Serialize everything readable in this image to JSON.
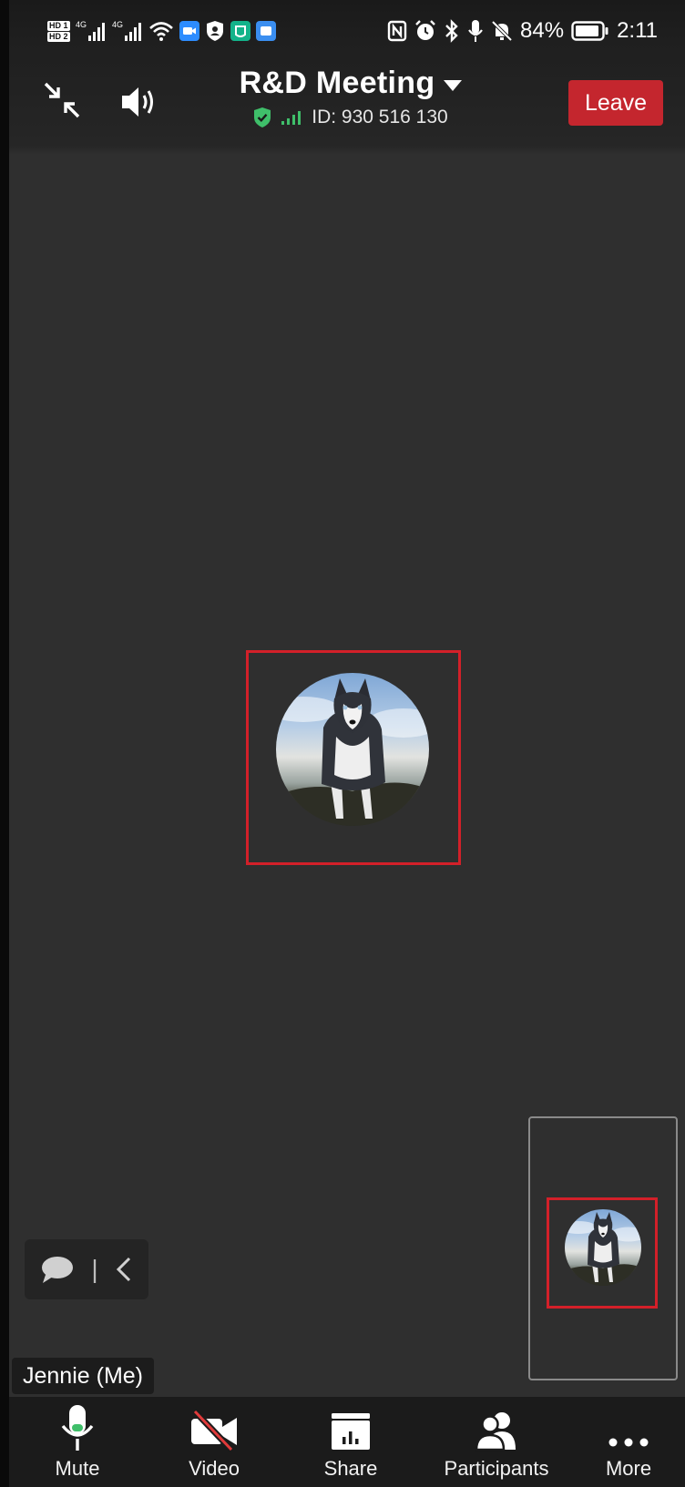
{
  "status_bar": {
    "hd_labels": [
      "HD 1",
      "HD 2"
    ],
    "network_labels": [
      "4G",
      "4G"
    ],
    "battery_percent": "84%",
    "time": "2:11"
  },
  "header": {
    "meeting_title": "R&D Meeting",
    "meeting_id": "ID: 930 516 130",
    "leave_label": "Leave"
  },
  "chat": {
    "separator": "|"
  },
  "self_view": {
    "name": "Jennie (Me)"
  },
  "toolbar": {
    "mute": "Mute",
    "video": "Video",
    "share": "Share",
    "participants": "Participants",
    "more": "More"
  },
  "colors": {
    "leave_button": "#c4262e",
    "highlight_frame": "#d32029",
    "secure_shield": "#3fbf6a",
    "background": "#2f2f2f"
  }
}
